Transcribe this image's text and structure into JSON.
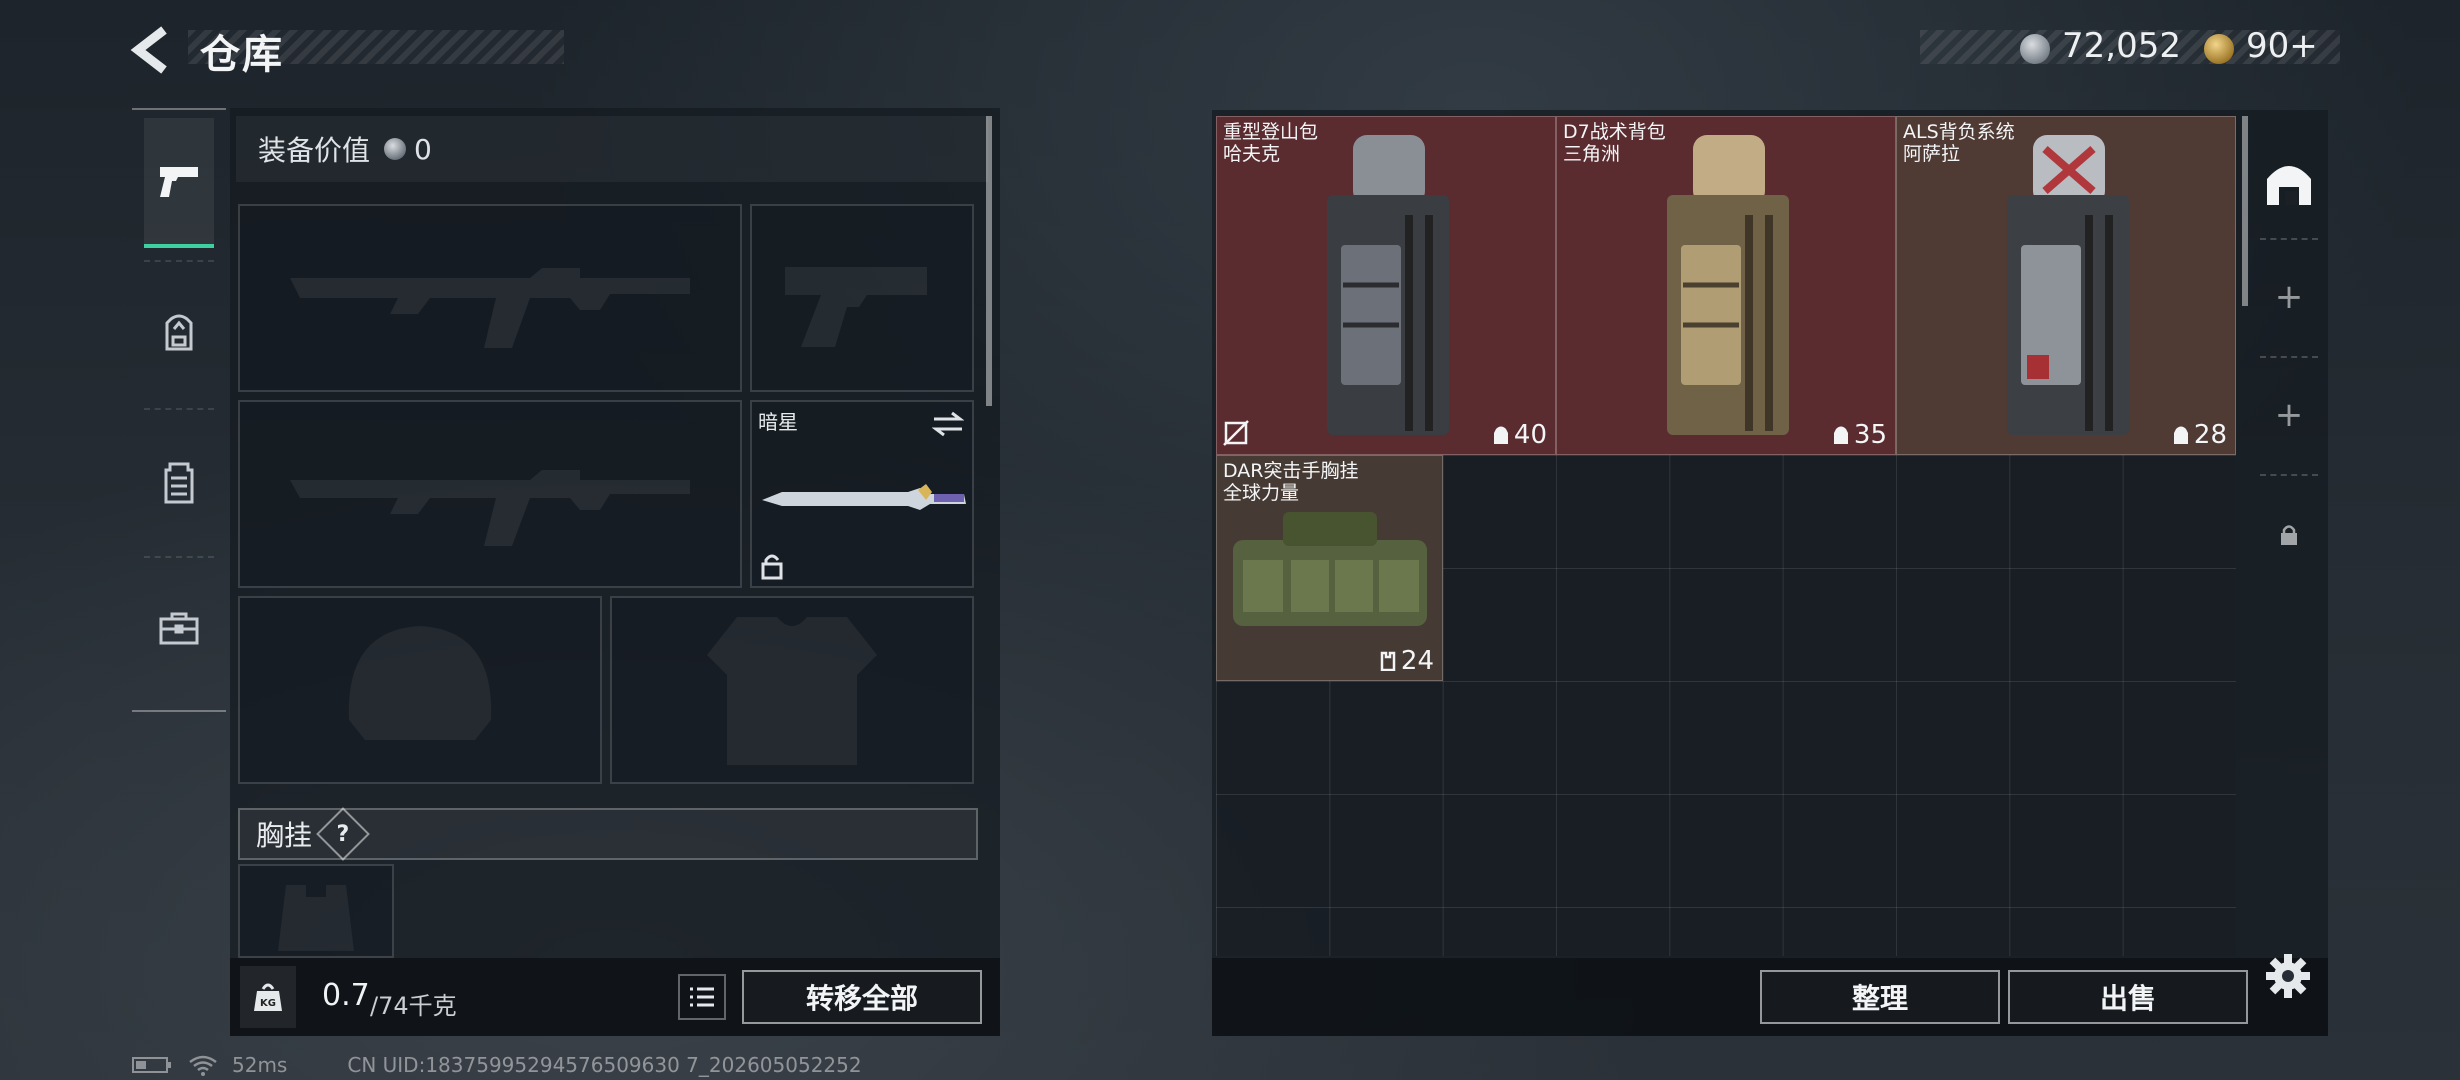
{
  "header": {
    "title": "仓库",
    "currency_a": "72,052",
    "currency_b": "90+"
  },
  "sidebar": {
    "tabs": [
      {
        "icon": "pistol-icon",
        "active": true
      },
      {
        "icon": "backpack-icon",
        "active": false
      },
      {
        "icon": "vest-icon",
        "active": false
      },
      {
        "icon": "toolbox-icon",
        "active": false
      }
    ]
  },
  "loadout": {
    "value_label": "装备价值",
    "value": "0",
    "melee_name": "暗星",
    "chest_rig_label": "胸挂",
    "chest_rig_help": "?",
    "weight_current": "0.7",
    "weight_max": "/74千克",
    "transfer_all_label": "转移全部"
  },
  "storage": {
    "items": [
      {
        "name": "重型登山包",
        "brand": "哈夫克",
        "capacity": "40",
        "bg": "#5a2b2f"
      },
      {
        "name": "D7战术背包",
        "brand": "三角洲",
        "capacity": "35",
        "bg": "#5a2b2f"
      },
      {
        "name": "ALS背负系统",
        "brand": "阿萨拉",
        "capacity": "28",
        "bg": "#4f3a34"
      },
      {
        "name": "DAR突击手胸挂",
        "brand": "全球力量",
        "capacity": "24",
        "bg": "#463a34"
      }
    ],
    "organize_label": "整理",
    "sell_label": "出售",
    "tabs": [
      "+",
      "+"
    ]
  },
  "status": {
    "ping": "52ms",
    "uid": "CN UID:18375995294576509630 7_202605052252"
  },
  "colors": {
    "accent": "#3fd0a0",
    "red_rarity": "#5a2b2f",
    "brown_rarity": "#4f3a34"
  }
}
